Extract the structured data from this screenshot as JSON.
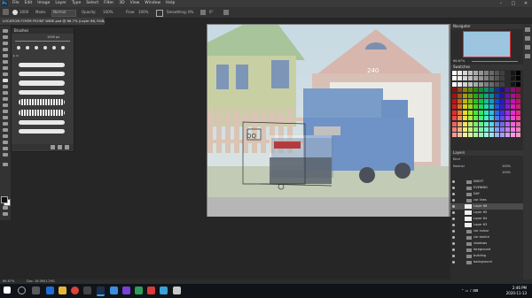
{
  "app": {
    "logo": "Ps"
  },
  "menu": [
    "File",
    "Edit",
    "Image",
    "Layer",
    "Type",
    "Select",
    "Filter",
    "3D",
    "View",
    "Window",
    "Help"
  ],
  "window_controls": [
    "–",
    "□",
    "✕"
  ],
  "options": {
    "size": "1000",
    "mode_label": "Mode:",
    "mode": "Normal",
    "opacity_label": "Opacity:",
    "opacity": "100%",
    "flow_label": "Flow:",
    "flow": "100%",
    "smoothing_label": "Smoothing:",
    "smoothing": "0%",
    "angle": "0°"
  },
  "document_tab": "LOCATION FOYER FRONT WIDE.psd @ 66.7% (Layer 66, RGB/8) *",
  "brush_panel": {
    "title": "Brushes",
    "size_value": "1000 px"
  },
  "canvas": {
    "house_number": "240"
  },
  "navigator": {
    "title": "Navigator",
    "zoom": "66.67%"
  },
  "swatches": {
    "title": "Swatches"
  },
  "layers_panel": {
    "title": "Layers",
    "filter_label": "Kind",
    "blend_mode": "Normal",
    "opacity": "100%",
    "fill": "100%",
    "rows": [
      {
        "name": "NIGHT",
        "type": "folder"
      },
      {
        "name": "EVENING",
        "type": "folder"
      },
      {
        "name": "DAY",
        "type": "folder"
      },
      {
        "name": "car lines",
        "type": "folder"
      },
      {
        "name": "Layer 66",
        "type": "layer",
        "selected": true
      },
      {
        "name": "Layer 65",
        "type": "layer"
      },
      {
        "name": "Layer 64",
        "type": "layer"
      },
      {
        "name": "Layer 63",
        "type": "layer"
      },
      {
        "name": "car colour",
        "type": "folder"
      },
      {
        "name": "car sketch",
        "type": "folder"
      },
      {
        "name": "shadows",
        "type": "folder"
      },
      {
        "name": "foreground",
        "type": "folder"
      },
      {
        "name": "building",
        "type": "folder"
      },
      {
        "name": "background",
        "type": "folder"
      }
    ]
  },
  "status": {
    "zoom": "66.67%",
    "doc": "Doc: 18.0M/1.29G"
  },
  "taskbar": {
    "time": "2:46 PM",
    "date": "2020-11-13"
  }
}
